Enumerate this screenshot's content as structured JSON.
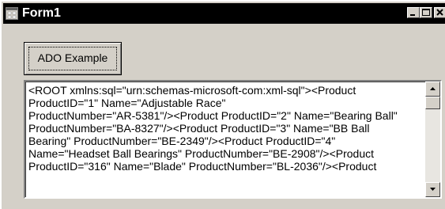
{
  "window": {
    "title": "Form1",
    "icon": "form-app-icon",
    "controls": [
      "minimize-icon",
      "maximize-icon",
      "close-icon"
    ]
  },
  "form": {
    "button_label": "ADO Example",
    "output_lines": [
      "<ROOT xmlns:sql=\"urn:schemas-microsoft-com:xml-sql\"><Product",
      "ProductID=\"1\" Name=\"Adjustable Race\"",
      "ProductNumber=\"AR-5381\"/><Product ProductID=\"2\" Name=\"Bearing Ball\"",
      "ProductNumber=\"BA-8327\"/><Product ProductID=\"3\" Name=\"BB Ball",
      "Bearing\" ProductNumber=\"BE-2349\"/><Product ProductID=\"4\"",
      "Name=\"Headset Ball Bearings\" ProductNumber=\"BE-2908\"/><Product",
      "ProductID=\"316\" Name=\"Blade\" ProductNumber=\"BL-2036\"/><Product"
    ]
  },
  "colors": {
    "titlebar": "#000000",
    "face": "#d4d0c8",
    "text": "#000000"
  }
}
